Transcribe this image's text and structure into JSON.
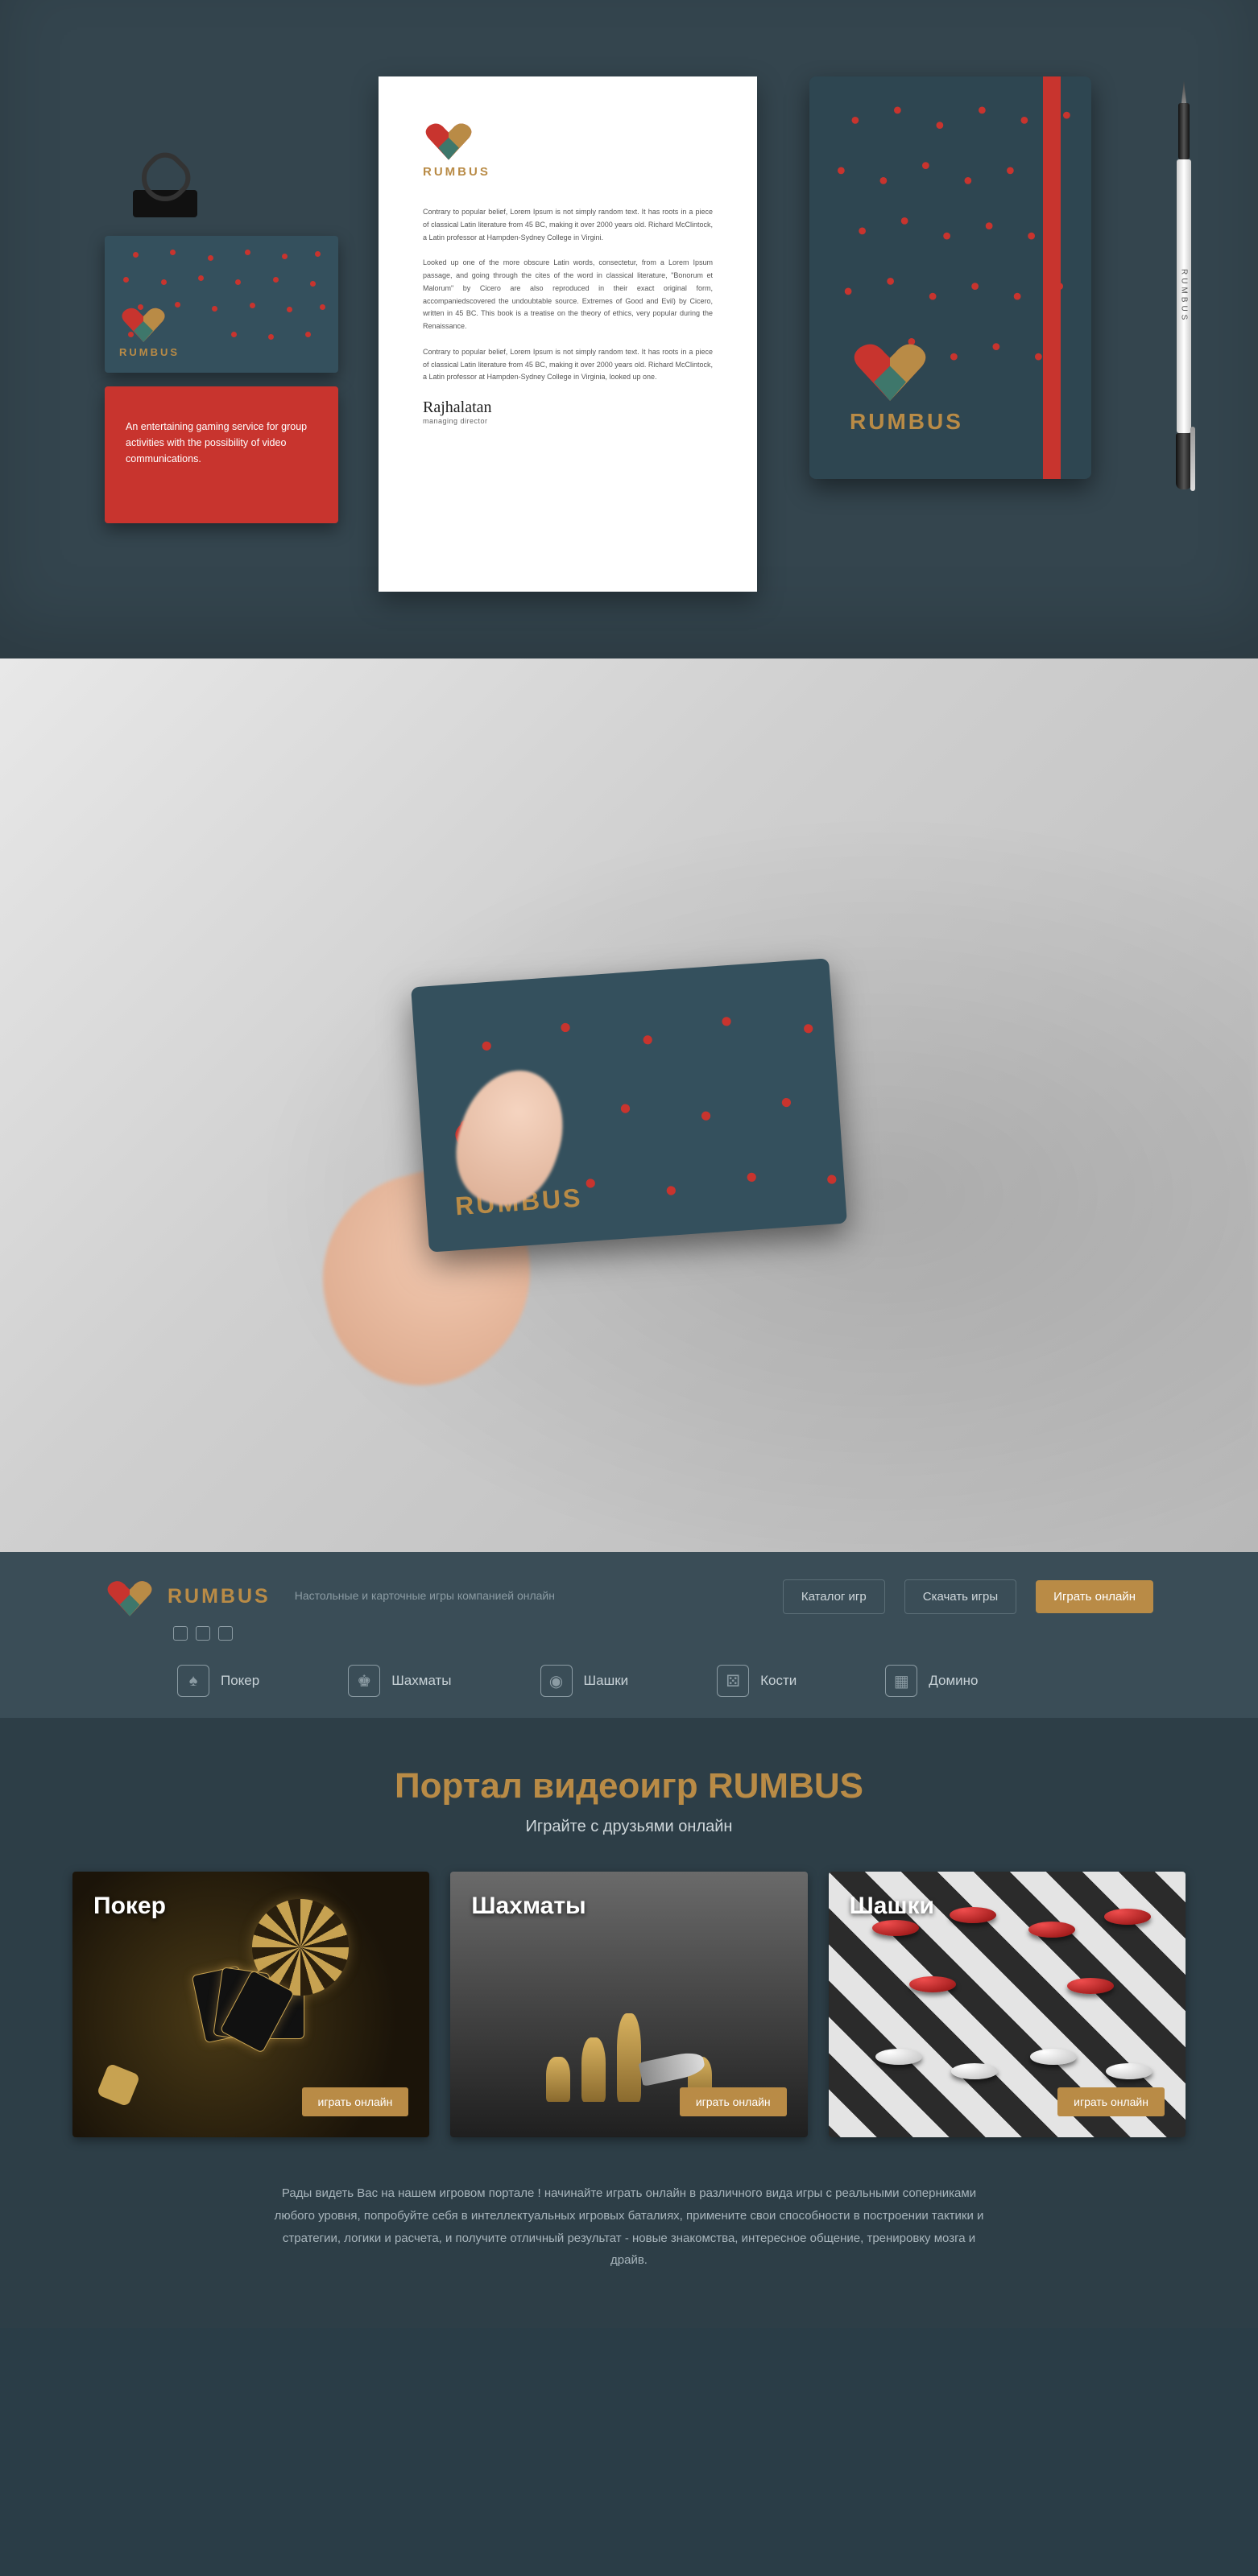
{
  "brand_name": "RUMBUS",
  "colors": {
    "accent_gold": "#b98b46",
    "accent_red": "#c8342e",
    "bg_teal": "#34505d",
    "site_bg": "#2d3e47"
  },
  "bizcard_back_text": "An entertaining gaming service for group activities with the possibility of video communications.",
  "letter": {
    "p1": "Contrary to popular belief, Lorem Ipsum is not simply random text. It has roots in a piece of classical Latin literature from 45 BC, making it over 2000 years old. Richard McClintock, a Latin professor at Hampden-Sydney College in Virgini.",
    "p2": "Looked up one of the more obscure Latin words, consectetur, from a Lorem Ipsum passage, and going through the cites of the word in classical literature, \"Bonorum et Malorum\" by Cicero are also reproduced in their exact original form, accompaniedscovered the undoubtable source. Extremes of Good and Evil) by Cicero, written in 45 BC. This book is a treatise on the theory of ethics, very popular during the Renaissance.",
    "p3": "Contrary to popular belief, Lorem Ipsum is not simply random text. It has roots in a piece of classical Latin literature from 45 BC, making it over 2000 years old. Richard McClintock, a Latin professor at Hampden-Sydney College in Virginia, looked up one.",
    "signature": "Rajhalatan",
    "signer_title": "managing director"
  },
  "pen_label": "RUMBUS",
  "site": {
    "tagline": "Настольные и карточные игры компанией онлайн",
    "buttons": {
      "catalog": "Каталог игр",
      "download": "Скачать игры",
      "play": "Играть онлайн"
    },
    "nav": {
      "poker": "Покер",
      "chess": "Шахматы",
      "checkers": "Шашки",
      "dice": "Кости",
      "domino": "Домино"
    },
    "hero_title": "Портал видеоигр RUMBUS",
    "hero_sub": "Играйте с друзьями онлайн",
    "games": {
      "poker": "Покер",
      "chess": "Шахматы",
      "checkers": "Шашки",
      "play_btn": "играть онлайн"
    },
    "welcome_text": "Рады видеть Вас на нашем игровом портале ! начинайте играть онлайн в различного вида игры с реальными соперниками любого уровня, попробуйте себя в интеллектуальных игровых баталиях, примените свои способности в построении тактики и стратегии, логики и расчета, и получите отличный результат - новые знакомства, интересное общение, тренировку мозга и драйв."
  }
}
